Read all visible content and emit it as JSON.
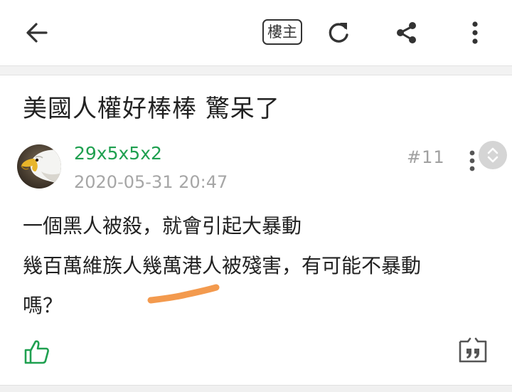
{
  "toolbar": {
    "op_label": "樓主",
    "icons": [
      "arrow-left-icon",
      "refresh-icon",
      "share-icon",
      "more-vertical-icon"
    ]
  },
  "thread": {
    "title": "美國人權好棒棒  驚呆了"
  },
  "post": {
    "username": "29x5x5x2",
    "timestamp": "2020-05-31 20:47",
    "floor": "#11",
    "lines": [
      "一個黑人被殺，就會引起大暴動",
      "幾百萬維族人幾萬港人被殘害，有可能不暴動",
      "嗎？"
    ],
    "icons": [
      "thumbs-up-icon",
      "quote-icon"
    ]
  },
  "colors": {
    "username": "#1fa050",
    "timestamp": "#a6a6a6",
    "floor": "#a0a0a0",
    "annotation": "#f39a4e",
    "like": "#1fa050"
  }
}
